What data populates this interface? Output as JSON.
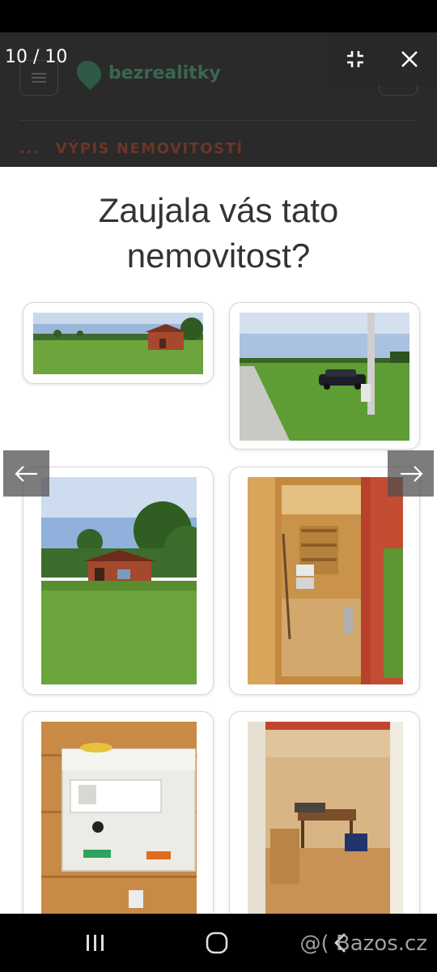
{
  "site": {
    "logo_text": "bezrealitky",
    "breadcrumb_prefix": "...",
    "breadcrumb_text": "VÝPIS NEMOVITOSTÍ"
  },
  "lightbox": {
    "counter": "10 / 10",
    "exit_fullscreen_icon": "exit-fullscreen-icon",
    "close_icon": "close-icon",
    "prev_icon": "arrow-left-icon",
    "next_icon": "arrow-right-icon"
  },
  "slide": {
    "title": "Zaujala vás tato nemovitost?",
    "photos": [
      "panorama-field-cabin",
      "road-car-pole",
      "cabin-on-meadow",
      "cabin-interior-storage",
      "electrical-box",
      "cabin-interior-table"
    ]
  },
  "system_nav": {
    "recent_icon": "recent-apps-icon",
    "home_icon": "home-icon",
    "back_icon": "back-icon"
  },
  "watermark": "@( Bazos.cz",
  "colors": {
    "brand_green": "#2e5a45",
    "breadcrumb": "#6b3626",
    "lightbox_bg": "#000000"
  }
}
